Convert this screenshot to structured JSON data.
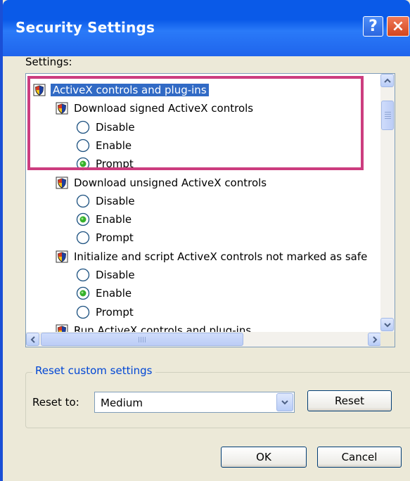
{
  "window": {
    "title": "Security Settings"
  },
  "titlebar": {
    "help": "?",
    "close": "×"
  },
  "settings_label": "Settings:",
  "tree": {
    "items": [
      {
        "type": "category",
        "label": "ActiveX controls and plug-ins",
        "level": 0,
        "selected": true
      },
      {
        "type": "setting",
        "label": "Download signed ActiveX controls",
        "level": 1
      },
      {
        "type": "option",
        "label": "Disable",
        "level": 2,
        "checked": false
      },
      {
        "type": "option",
        "label": "Enable",
        "level": 2,
        "checked": false
      },
      {
        "type": "option",
        "label": "Prompt",
        "level": 2,
        "checked": true
      },
      {
        "type": "setting",
        "label": "Download unsigned ActiveX controls",
        "level": 1
      },
      {
        "type": "option",
        "label": "Disable",
        "level": 2,
        "checked": false
      },
      {
        "type": "option",
        "label": "Enable",
        "level": 2,
        "checked": true
      },
      {
        "type": "option",
        "label": "Prompt",
        "level": 2,
        "checked": false
      },
      {
        "type": "setting",
        "label": "Initialize and script ActiveX controls not marked as safe",
        "level": 1
      },
      {
        "type": "option",
        "label": "Disable",
        "level": 2,
        "checked": false
      },
      {
        "type": "option",
        "label": "Enable",
        "level": 2,
        "checked": true
      },
      {
        "type": "option",
        "label": "Prompt",
        "level": 2,
        "checked": false
      },
      {
        "type": "setting",
        "label": "Run ActiveX controls and plug-ins",
        "level": 1
      }
    ]
  },
  "reset_group": {
    "legend": "Reset custom settings",
    "reset_to_label": "Reset to:",
    "selected_level": "Medium",
    "reset_button": "Reset"
  },
  "buttons": {
    "ok": "OK",
    "cancel": "Cancel"
  },
  "colors": {
    "titlebar": "#0a5ae8",
    "selection": "#316ac5",
    "highlight_box": "#cc3d7f",
    "legend": "#0046d5"
  }
}
